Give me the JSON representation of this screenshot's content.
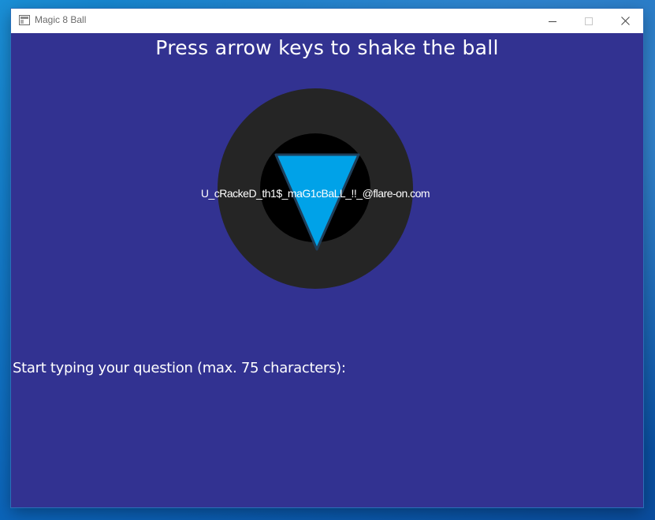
{
  "window": {
    "title": "Magic 8 Ball",
    "controls": {
      "minimize": "minimize-icon",
      "maximize": "maximize-icon",
      "close": "close-icon"
    }
  },
  "game": {
    "heading": "Press arrow keys to shake the ball",
    "answer_text": "U_cRackeD_th1$_maG1cBaLL_!!_@flare-on.com",
    "prompt": "Start typing your question (max. 75 characters):",
    "question_value": ""
  },
  "colors": {
    "background": "#323291",
    "ball_outer": "#252525",
    "ball_inner": "#000000",
    "triangle": "#00a2e8",
    "text": "#ffffff"
  }
}
